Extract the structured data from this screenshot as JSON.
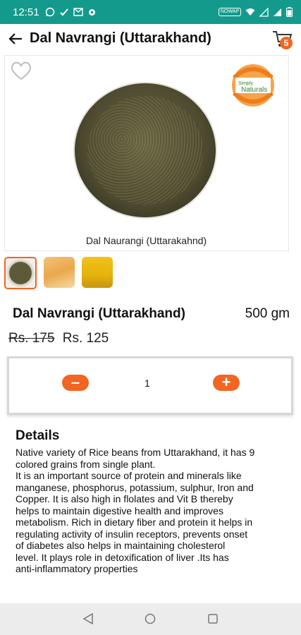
{
  "status_bar": {
    "time": "12:51",
    "network_label": "NOWAP",
    "battery_level": 0.85
  },
  "app_bar": {
    "title": "Dal Navrangi (Uttarakhand)",
    "cart_count": "5"
  },
  "hero": {
    "brand_line1": "Simply",
    "brand_line2": "Naturals",
    "caption": "Dal Naurangi (Uttarakahnd)"
  },
  "thumbnails": [
    {
      "name": "thumb-bowl",
      "active": true
    },
    {
      "name": "thumb-pack-1",
      "active": false
    },
    {
      "name": "thumb-pack-2",
      "active": false
    }
  ],
  "product": {
    "name": "Dal Navrangi (Uttarakhand)",
    "weight": "500 gm",
    "old_price": "Rs. 175",
    "price": "Rs. 125"
  },
  "quantity": {
    "value": "1"
  },
  "details": {
    "heading": "Details",
    "body": "Native variety of Rice beans from Uttarakhand, it has 9\ncolored  grains from single plant.\nIt is an important source of  protein and  minerals like\nmanganese, phosphorus, potassium, sulphur, Iron and\nCopper. It is also  high in flolates and Vit B  thereby\nhelps to  maintain digestive health and improves\nmetabolism. Rich in dietary fiber and protein it helps in\nregulating activity of insulin receptors, prevents onset\nof diabetes  also helps  in maintaining cholesterol\nlevel. It plays role in detoxification of liver .Its has\nanti-inflammatory properties"
  },
  "colors": {
    "status_bar": "#149a8c",
    "accent": "#f26522"
  }
}
